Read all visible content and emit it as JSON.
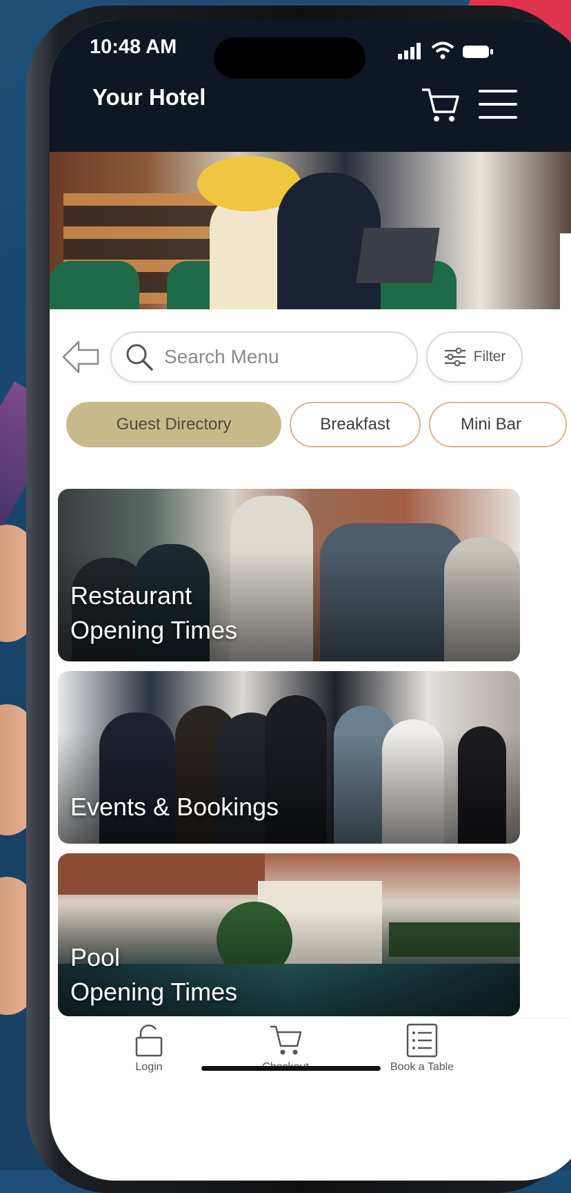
{
  "status": {
    "time": "10:48 AM"
  },
  "header": {
    "title": "Your Hotel"
  },
  "search": {
    "placeholder": "Search Menu",
    "filter_label": "Filter"
  },
  "categories": [
    "Guest Directory",
    "Breakfast",
    "Mini Bar"
  ],
  "cards": [
    {
      "line1": "Restaurant",
      "line2": "Opening Times"
    },
    {
      "line1": "Events & Bookings",
      "line2": ""
    },
    {
      "line1": "Pool",
      "line2": "Opening Times"
    }
  ],
  "bottom_nav": [
    {
      "label": "Login",
      "icon": "lock-icon"
    },
    {
      "label": "Checkout",
      "icon": "cart-icon"
    },
    {
      "label": "Book a Table",
      "icon": "list-icon"
    }
  ],
  "colors": {
    "header_bg": "#0f1624",
    "chip_active": "#c8b98a",
    "chip_border": "#d9b48f"
  }
}
